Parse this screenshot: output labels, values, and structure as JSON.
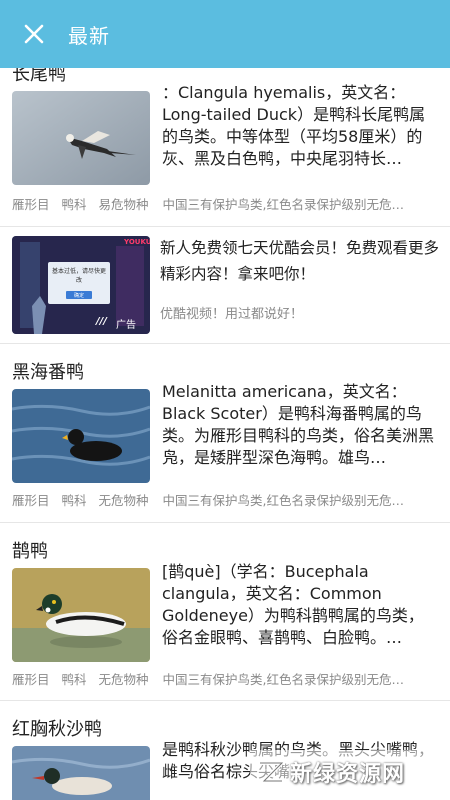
{
  "header": {
    "title": "最新",
    "close_icon": "close-icon",
    "background": "#5bbde0"
  },
  "entries": [
    {
      "title": "长尾鸭",
      "summary": "：Clangula hyemalis，英文名：Long-tailed Duck）是鸭科长尾鸭属的鸟类。中等体型（平均58厘米）的灰、黑及白色鸭，中央尾羽特长…",
      "tags": [
        "雁形目",
        "鸭科",
        "易危物种"
      ],
      "protection": "中国三有保护鸟类,红色名录保护级别无危…"
    },
    {
      "title": "黑海番鸭",
      "summary": "Melanitta americana，英文名：Black Scoter）是鸭科海番鸭属的鸟类。为雁形目鸭科的鸟类，俗名美洲黑凫，是矮胖型深色海鸭。雄鸟…",
      "tags": [
        "雁形目",
        "鸭科",
        "无危物种"
      ],
      "protection": "中国三有保护鸟类,红色名录保护级别无危…"
    },
    {
      "title": "鹊鸭",
      "summary": "[鹊què]（学名：Bucephala clangula，英文名：Common Goldeneye）为鸭科鹊鸭属的鸟类，俗名金眼鸭、喜鹊鸭、白脸鸭。…",
      "tags": [
        "雁形目",
        "鸭科",
        "无危物种"
      ],
      "protection": "中国三有保护鸟类,红色名录保护级别无危…"
    },
    {
      "title": "红胸秋沙鸭",
      "summary": "是鸭科秋沙鸭属的鸟类。黑头尖嘴鸭，雌鸟俗名棕头尖嘴"
    }
  ],
  "ad": {
    "text": "新人免费领七天优酷会员！免费观看更多精彩内容！拿来吧你！",
    "source": "优酷视频！用过都说好！",
    "label": "广告",
    "dialog_text": "基本过低，请尽快更改",
    "dialog_button": "确定",
    "brand": "YOUKU"
  },
  "watermark": {
    "text": "新绿资源网"
  }
}
